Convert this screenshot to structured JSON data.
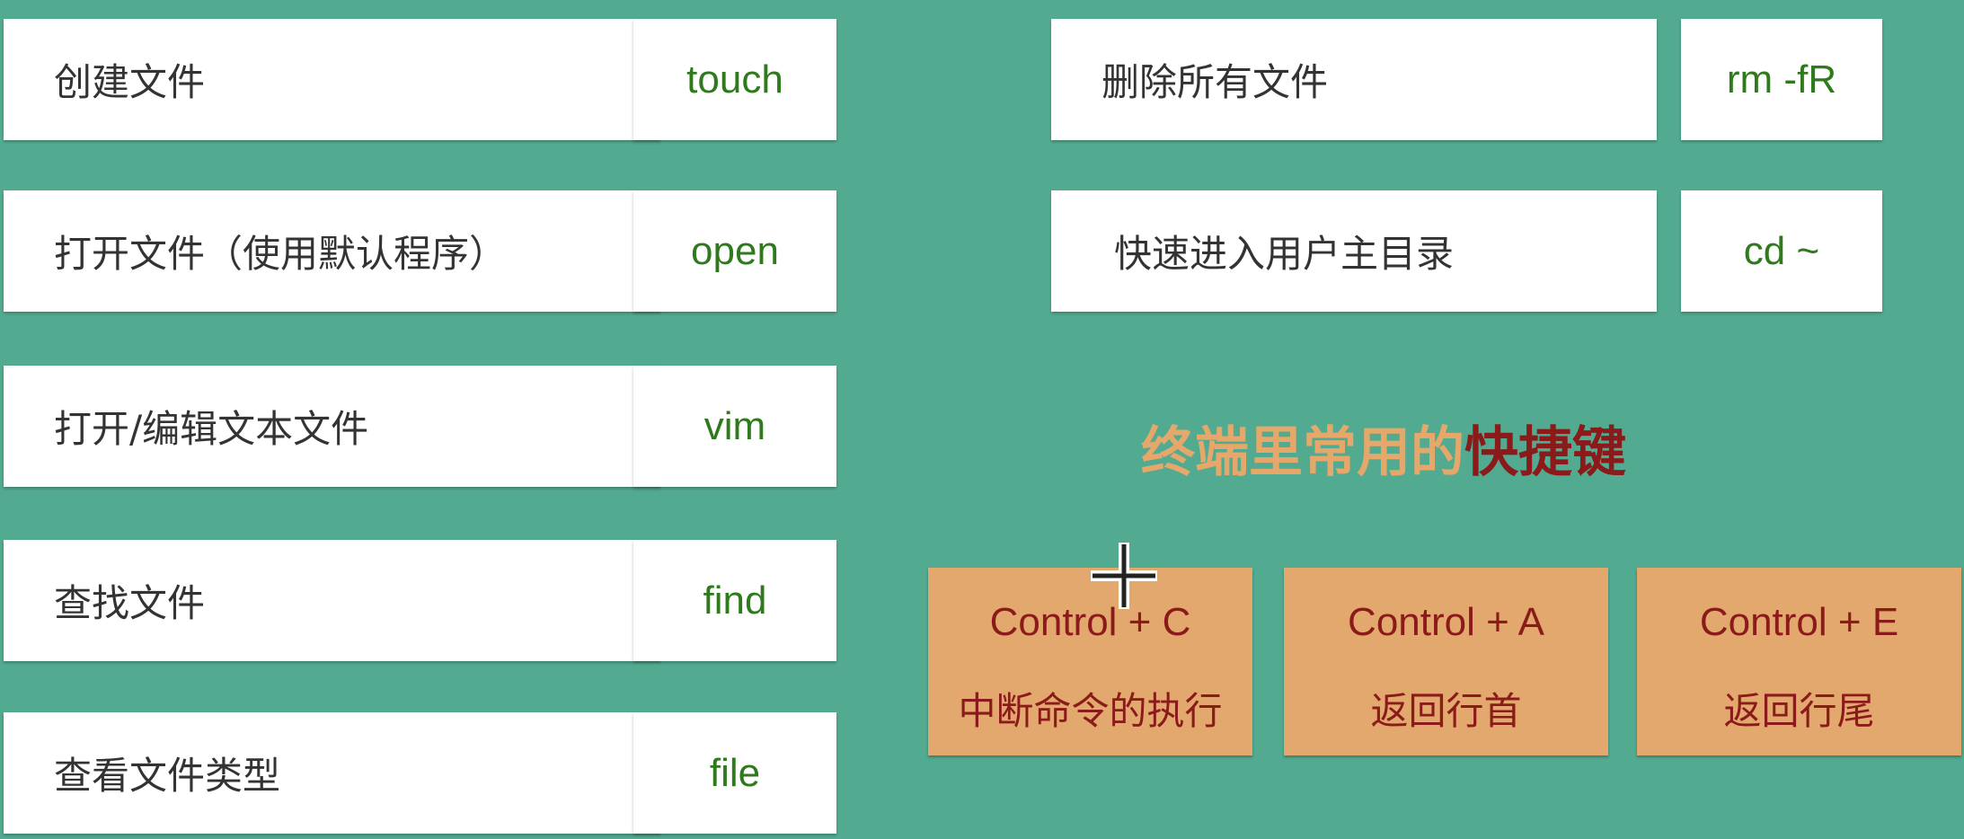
{
  "commands_left": [
    {
      "desc": "创建文件",
      "cmd": "touch"
    },
    {
      "desc": "打开文件（使用默认程序）",
      "cmd": "open"
    },
    {
      "desc": "打开/编辑文本文件",
      "cmd": "vim"
    },
    {
      "desc": "查找文件",
      "cmd": "find"
    },
    {
      "desc": "查看文件类型",
      "cmd": "file"
    }
  ],
  "commands_right": [
    {
      "desc": "删除所有文件",
      "cmd": "rm -fR"
    },
    {
      "desc": "快速进入用户主目录",
      "cmd": "cd ~"
    }
  ],
  "shortcuts_title": {
    "normal": "终端里常用的",
    "highlight": "快捷键"
  },
  "shortcuts": [
    {
      "key": "Control + C",
      "desc": "中断命令的执行"
    },
    {
      "key": "Control + A",
      "desc": "返回行首"
    },
    {
      "key": "Control + E",
      "desc": "返回行尾"
    }
  ],
  "colors": {
    "background": "#52ab91",
    "command": "#2e7a1c",
    "shortcut_bg": "#e3a86d",
    "shortcut_text": "#8b1a1a"
  }
}
